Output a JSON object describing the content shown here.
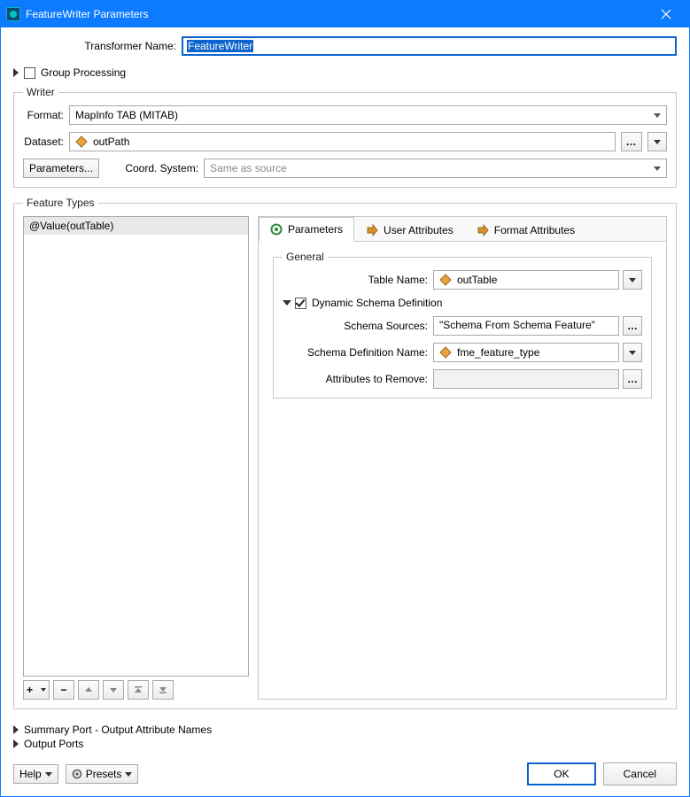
{
  "window": {
    "title": "FeatureWriter Parameters"
  },
  "transformer": {
    "label": "Transformer Name:",
    "value": "FeatureWriter"
  },
  "group_processing": {
    "label": "Group Processing",
    "checked": false
  },
  "writer": {
    "legend": "Writer",
    "format_label": "Format:",
    "format_value": "MapInfo TAB (MITAB)",
    "dataset_label": "Dataset:",
    "dataset_value": "outPath",
    "parameters_btn": "Parameters...",
    "coord_label": "Coord. System:",
    "coord_placeholder": "Same as source"
  },
  "feature_types": {
    "legend": "Feature Types",
    "items": [
      "@Value(outTable)"
    ],
    "tabs": {
      "parameters": "Parameters",
      "user_attributes": "User Attributes",
      "format_attributes": "Format Attributes"
    },
    "general": {
      "legend": "General",
      "table_name_label": "Table Name:",
      "table_name_value": "outTable",
      "dynamic_schema_label": "Dynamic Schema Definition",
      "dynamic_schema_checked": true,
      "schema_sources_label": "Schema Sources:",
      "schema_sources_value": "\"Schema From Schema Feature\"",
      "schema_def_name_label": "Schema Definition Name:",
      "schema_def_name_value": "fme_feature_type",
      "attrs_remove_label": "Attributes to Remove:",
      "attrs_remove_value": ""
    }
  },
  "summary_port": {
    "label": "Summary Port - Output Attribute Names"
  },
  "output_ports": {
    "label": "Output Ports"
  },
  "footer": {
    "help": "Help",
    "presets": "Presets",
    "ok": "OK",
    "cancel": "Cancel"
  }
}
